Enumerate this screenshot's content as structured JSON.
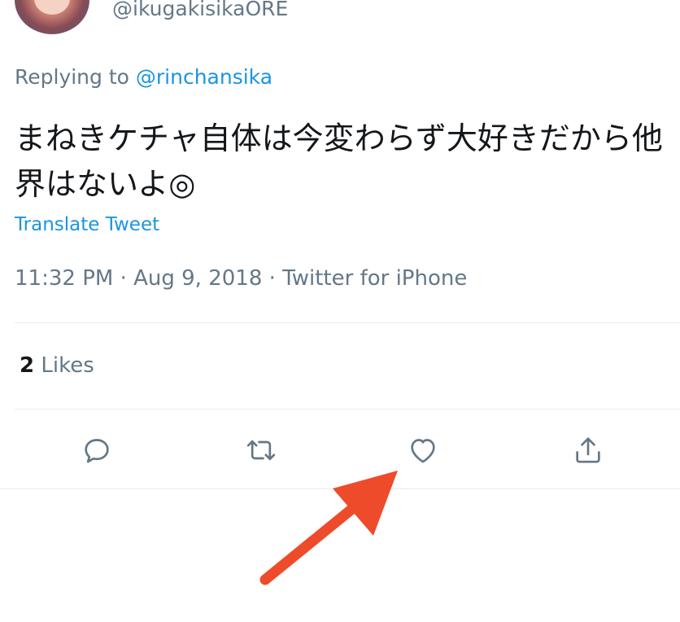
{
  "tweet": {
    "handle": "@ikugakisikaORE",
    "replying_prefix": "Replying to ",
    "replying_to": "@rinchansika",
    "text": "まねきケチャ自体は今変わらず大好きだから他界はないよ◎",
    "translate_label": "Translate Tweet",
    "timestamp": "11:32 PM · Aug 9, 2018 · Twitter for iPhone",
    "likes_count": "2",
    "likes_label": " Likes"
  },
  "actions": [
    {
      "name": "reply",
      "icon": "speech-bubble-icon"
    },
    {
      "name": "retweet",
      "icon": "retweet-icon"
    },
    {
      "name": "like",
      "icon": "heart-icon"
    },
    {
      "name": "share",
      "icon": "share-icon"
    }
  ],
  "colors": {
    "text": "#14171a",
    "secondary": "#657786",
    "link": "#1b95e0",
    "divider": "#e6ecf0",
    "annotation_arrow": "#ee4b2b"
  }
}
